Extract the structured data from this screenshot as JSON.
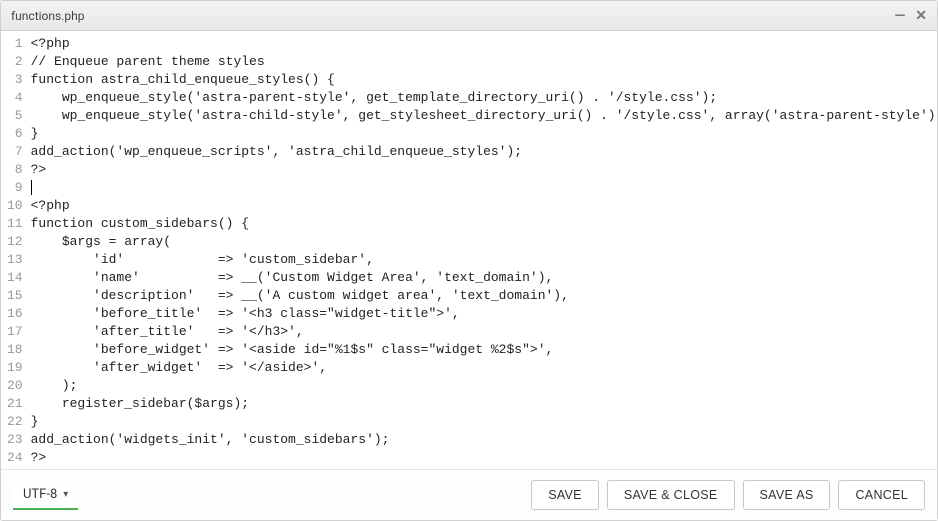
{
  "window": {
    "title": "functions.php"
  },
  "code": {
    "lines": [
      "<?php",
      "// Enqueue parent theme styles",
      "function astra_child_enqueue_styles() {",
      "    wp_enqueue_style('astra-parent-style', get_template_directory_uri() . '/style.css');",
      "    wp_enqueue_style('astra-child-style', get_stylesheet_directory_uri() . '/style.css', array('astra-parent-style'));",
      "}",
      "add_action('wp_enqueue_scripts', 'astra_child_enqueue_styles');",
      "?>",
      "",
      "<?php",
      "function custom_sidebars() {",
      "    $args = array(",
      "        'id'            => 'custom_sidebar',",
      "        'name'          => __('Custom Widget Area', 'text_domain'),",
      "        'description'   => __('A custom widget area', 'text_domain'),",
      "        'before_title'  => '<h3 class=\"widget-title\">',",
      "        'after_title'   => '</h3>',",
      "        'before_widget' => '<aside id=\"%1$s\" class=\"widget %2$s\">',",
      "        'after_widget'  => '</aside>',",
      "    );",
      "    register_sidebar($args);",
      "}",
      "add_action('widgets_init', 'custom_sidebars');",
      "?>"
    ],
    "cursor_line_index": 8
  },
  "footer": {
    "encoding": "UTF-8",
    "buttons": {
      "save": "SAVE",
      "save_close": "SAVE & CLOSE",
      "save_as": "SAVE AS",
      "cancel": "CANCEL"
    }
  }
}
